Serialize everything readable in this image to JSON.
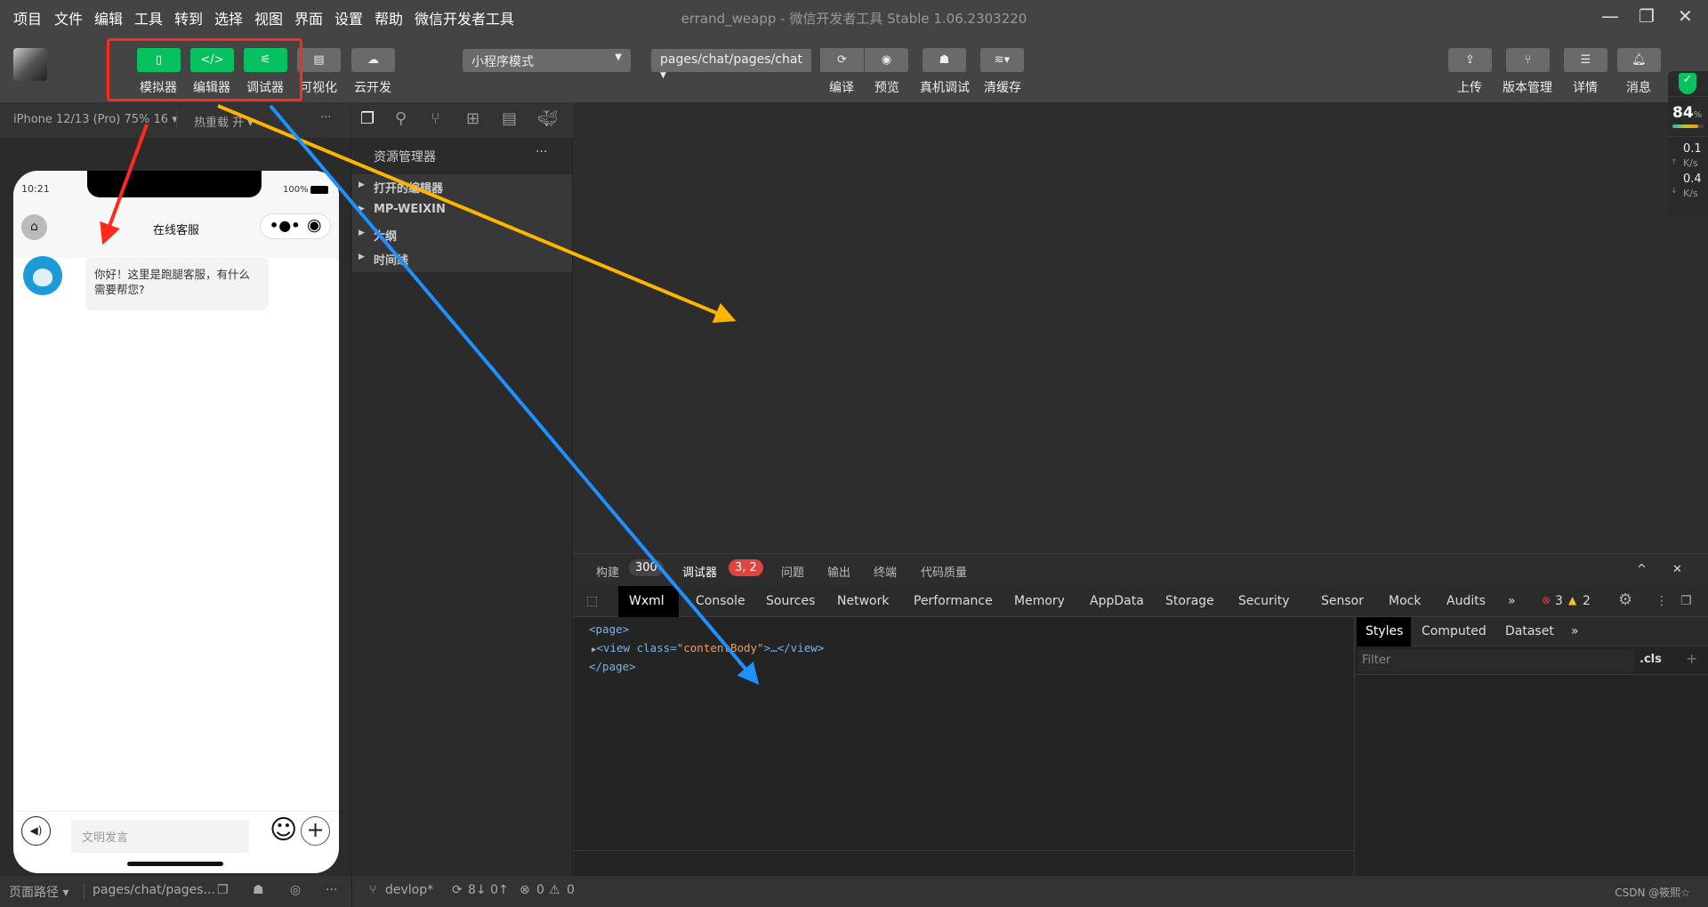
{
  "menubar": {
    "items": [
      "项目",
      "文件",
      "编辑",
      "工具",
      "转到",
      "选择",
      "视图",
      "界面",
      "设置",
      "帮助",
      "微信开发者工具"
    ],
    "title": "errand_weapp - 微信开发者工具 Stable 1.06.2303220"
  },
  "toolbar": {
    "left_buttons": [
      {
        "label": "模拟器",
        "icon": "phone-icon",
        "active": true
      },
      {
        "label": "编辑器",
        "icon": "code-icon",
        "active": true
      },
      {
        "label": "调试器",
        "icon": "debug-sliders-icon",
        "active": true
      },
      {
        "label": "可视化",
        "icon": "layout-icon",
        "active": false
      },
      {
        "label": "云开发",
        "icon": "cloud-icon",
        "active": false
      }
    ],
    "mode_select": "小程序模式",
    "page_select": "pages/chat/pages/chat",
    "mid_buttons": [
      {
        "label": "编译",
        "icon": "refresh-icon"
      },
      {
        "label": "预览",
        "icon": "eye-icon"
      },
      {
        "label": "真机调试",
        "icon": "bug-icon"
      },
      {
        "label": "清缓存",
        "icon": "layers-icon"
      }
    ],
    "right_buttons": [
      {
        "label": "上传",
        "icon": "upload-icon"
      },
      {
        "label": "版本管理",
        "icon": "branch-icon"
      },
      {
        "label": "详情",
        "icon": "menu-icon"
      },
      {
        "label": "消息",
        "icon": "bell-icon"
      }
    ]
  },
  "perf": {
    "cpu": "84",
    "cpu_unit": "%",
    "cpu_level": 84,
    "up": "0.1",
    "down": "0.4",
    "unit": "K/s"
  },
  "simulator": {
    "device": "iPhone 12/13 (Pro) 75% 16 ▾",
    "hot_reload": "热重载 开 ▾",
    "more": "···"
  },
  "phone": {
    "time": "10:21",
    "battery": "100%",
    "nav_title": "在线客服",
    "message": "你好！这里是跑腿客服，有什么需要帮您?",
    "input_placeholder": "文明发言"
  },
  "explorer": {
    "title": "资源管理器",
    "more": "···",
    "items": [
      "打开的编辑器",
      "MP-WEIXIN",
      "大纲",
      "时间线"
    ]
  },
  "debug": {
    "tabs": [
      {
        "label": "构建",
        "badge": "300"
      },
      {
        "label": "调试器",
        "badge": "3, 2"
      },
      {
        "label": "问题"
      },
      {
        "label": "输出"
      },
      {
        "label": "终端"
      },
      {
        "label": "代码质量"
      }
    ],
    "devtools_tabs": [
      "Wxml",
      "Console",
      "Sources",
      "Network",
      "Performance",
      "Memory",
      "AppData",
      "Storage",
      "Security",
      "Sensor",
      "Mock",
      "Audits"
    ],
    "errors": "3",
    "warnings": "2",
    "wxml": {
      "line1": "<page>",
      "line2_tag": "<view class=",
      "line2_attr": "\"contentBody\"",
      "line2_end": ">…</view>",
      "line3": "</page>"
    },
    "styles_tabs": [
      "Styles",
      "Computed",
      "Dataset"
    ],
    "filter_placeholder": "Filter",
    "cls": ".cls",
    "plus": "+"
  },
  "statusbar": {
    "page_path": "页面路径 ▾",
    "path": "pages/chat/pages...",
    "branch": "devlop*",
    "sync": "8↓ 0↑",
    "errors": "0",
    "warnings": "0",
    "watermark": "CSDN @筱熙☆"
  },
  "colors": {
    "accent": "#07c160",
    "annotation_red": "#ff2a1a",
    "annotation_yellow": "#ffb400",
    "annotation_blue": "#1e90ff",
    "error": "#e0443e"
  }
}
